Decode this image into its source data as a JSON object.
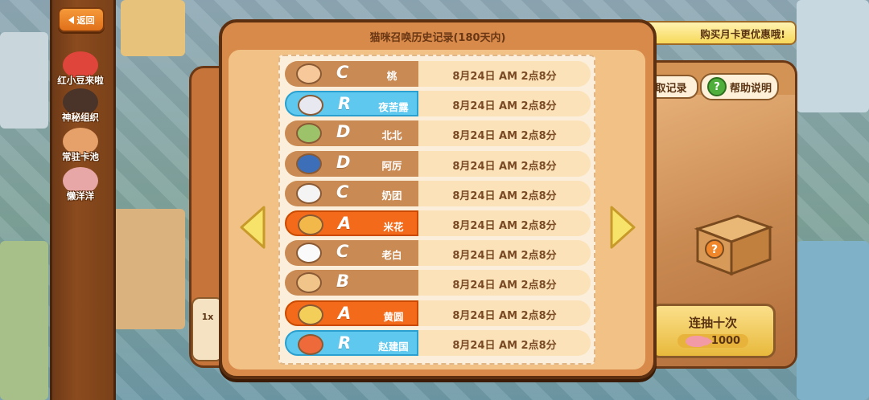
{
  "sidebar": {
    "back_label": "返回",
    "items": [
      {
        "label": "红小豆来啦",
        "color": "#e0453b"
      },
      {
        "label": "神秘组织",
        "color": "#6b4a3a"
      },
      {
        "label": "常驻卡池",
        "color": "#e6a06a"
      },
      {
        "label": "懒洋洋",
        "color": "#e8a7a7"
      }
    ]
  },
  "background_ui": {
    "monthly_card_text": "购买月卡更优惠哦!",
    "records_button": "取记录",
    "help_button": "帮助说明",
    "help_icon": "?",
    "ten_draw_label": "连抽十次",
    "ten_draw_price": "1000",
    "left_small_text": "1x"
  },
  "modal": {
    "title": "猫咪召唤历史记录(180天内)",
    "records": [
      {
        "grade": "C",
        "name": "桃",
        "time": "8月24日 AM 2点8分",
        "tier": "c",
        "avatar_color": "#f6c89a"
      },
      {
        "grade": "R",
        "name": "夜苦露",
        "time": "8月24日 AM 2点8分",
        "tier": "r",
        "avatar_color": "#e8e8f0"
      },
      {
        "grade": "D",
        "name": "北北",
        "time": "8月24日 AM 2点8分",
        "tier": "c",
        "avatar_color": "#9cc36a"
      },
      {
        "grade": "D",
        "name": "阿厉",
        "time": "8月24日 AM 2点8分",
        "tier": "c",
        "avatar_color": "#3c6fb8"
      },
      {
        "grade": "C",
        "name": "奶团",
        "time": "8月24日 AM 2点8分",
        "tier": "c",
        "avatar_color": "#f4f4f4"
      },
      {
        "grade": "A",
        "name": "米花",
        "time": "8月24日 AM 2点8分",
        "tier": "a",
        "avatar_color": "#f2b84a"
      },
      {
        "grade": "C",
        "name": "老白",
        "time": "8月24日 AM 2点8分",
        "tier": "c",
        "avatar_color": "#fafafa"
      },
      {
        "grade": "B",
        "name": "",
        "time": "8月24日 AM 2点8分",
        "tier": "c",
        "avatar_color": "#f1c48a"
      },
      {
        "grade": "A",
        "name": "黄圆",
        "time": "8月24日 AM 2点8分",
        "tier": "a",
        "avatar_color": "#f3cf5a"
      },
      {
        "grade": "R",
        "name": "赵建国",
        "time": "8月24日 AM 2点8分",
        "tier": "r",
        "avatar_color": "#ee6a3a"
      }
    ]
  },
  "colors": {
    "tier_c": "#c98a54",
    "tier_r": "#5fc8ee",
    "tier_a": "#f36a1a",
    "arrow": "#f7e36a"
  }
}
